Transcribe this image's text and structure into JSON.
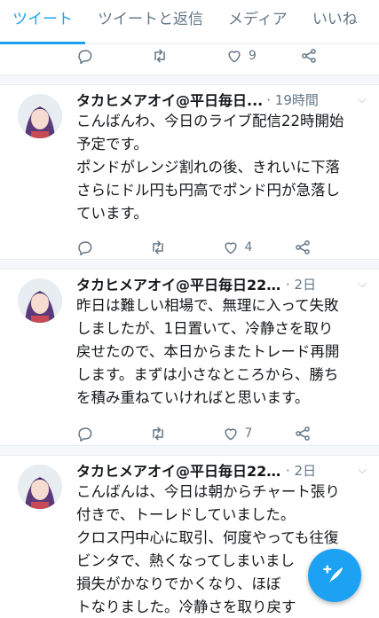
{
  "tabs": [
    {
      "label": "ツイート",
      "active": true
    },
    {
      "label": "ツイートと返信",
      "active": false
    },
    {
      "label": "メディア",
      "active": false
    },
    {
      "label": "いいね",
      "active": false
    }
  ],
  "first_actions": {
    "like_count": "9"
  },
  "tweets": [
    {
      "name": "タカヒメアオイ@平日毎日...",
      "time": "· 19時間",
      "text": "こんばんわ、今日のライブ配信22時開始\n予定です。\nポンドがレンジ割れの後、きれいに下落\nさらにドル円も円高でポンド円が急落し\nています。",
      "like_count": "4"
    },
    {
      "name": "タカヒメアオイ@平日毎日22...",
      "time": "· 2日",
      "text": "昨日は難しい相場で、無理に入って失敗\nしましたが、1日置いて、冷静さを取り\n戻せたので、本日からまたトレード再開\nします。まずは小さなところから、勝ち\nを積み重ねていければと思います。",
      "like_count": "7"
    },
    {
      "name": "タカヒメアオイ@平日毎日22...",
      "time": "· 2日",
      "text": "こんばんは、今日は朝からチャート張り\n付きで、トーレドしていました。\nクロス円中心に取引、何度やっても往復\nビンタで、熱くなってしまいまし\n損失がかなりでかくなり、ほぼ\nトなりました。冷静さを取り戻す\nに、今日の夜配信はお休みします。ユー"
    }
  ],
  "colors": {
    "accent": "#1da1f2",
    "muted": "#657786"
  }
}
